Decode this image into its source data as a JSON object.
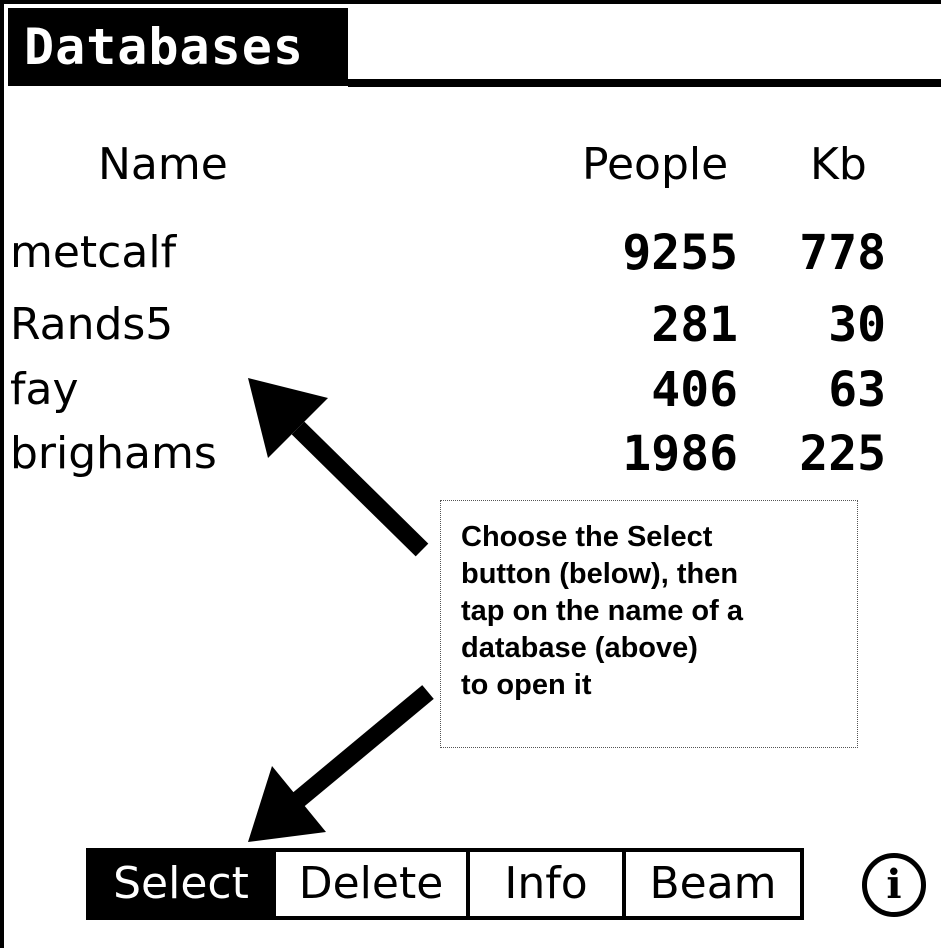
{
  "window": {
    "title": "Databases"
  },
  "columns": {
    "name": "Name",
    "people": "People",
    "kb": "Kb"
  },
  "databases": [
    {
      "name": "metcalf",
      "people": "9255",
      "kb": "778"
    },
    {
      "name": "Rands5",
      "people": "281",
      "kb": "30"
    },
    {
      "name": "fay",
      "people": "406",
      "kb": "63"
    },
    {
      "name": "brighams",
      "people": "1986",
      "kb": "225"
    }
  ],
  "callout": {
    "lines": [
      "Choose the Select",
      "button (below), then",
      "tap on the name of a",
      "database (above)",
      "to open it"
    ]
  },
  "buttons": {
    "select": "Select",
    "delete": "Delete",
    "info": "Info",
    "beam": "Beam",
    "info_icon": "i"
  },
  "icons": {
    "info": "info-circle-icon"
  }
}
